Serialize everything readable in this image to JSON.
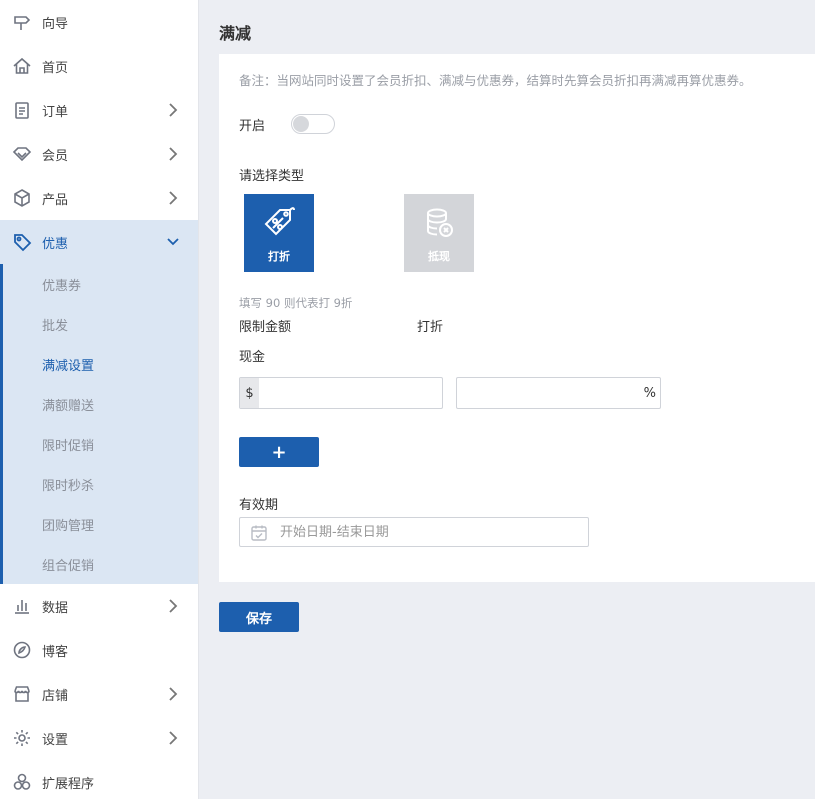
{
  "sidebar": {
    "items": [
      {
        "label": "向导",
        "icon": "signpost-icon",
        "has_chevron": false
      },
      {
        "label": "首页",
        "icon": "home-icon",
        "has_chevron": false
      },
      {
        "label": "订单",
        "icon": "clipboard-icon",
        "has_chevron": true
      },
      {
        "label": "会员",
        "icon": "diamond-icon",
        "has_chevron": true
      },
      {
        "label": "产品",
        "icon": "box-icon",
        "has_chevron": true
      },
      {
        "label": "优惠",
        "icon": "tag-icon",
        "has_chevron": true,
        "expanded": true,
        "active": true
      }
    ],
    "submenu": [
      {
        "label": "优惠券"
      },
      {
        "label": "批发"
      },
      {
        "label": "满减设置",
        "active": true
      },
      {
        "label": "满额赠送"
      },
      {
        "label": "限时促销"
      },
      {
        "label": "限时秒杀"
      },
      {
        "label": "团购管理"
      },
      {
        "label": "组合促销"
      }
    ],
    "items_after": [
      {
        "label": "数据",
        "icon": "bar-chart-icon",
        "has_chevron": true
      },
      {
        "label": "博客",
        "icon": "blog-icon",
        "has_chevron": false
      },
      {
        "label": "店铺",
        "icon": "store-icon",
        "has_chevron": true
      },
      {
        "label": "设置",
        "icon": "gear-icon",
        "has_chevron": true
      },
      {
        "label": "扩展程序",
        "icon": "extensions-icon",
        "has_chevron": false
      }
    ]
  },
  "page": {
    "title": "满减",
    "note": "备注：当网站同时设置了会员折扣、满减与优惠券，结算时先算会员折扣再满减再算优惠券。",
    "enable_label": "开启",
    "enable_on": false,
    "type_label": "请选择类型",
    "types": [
      {
        "label": "打折",
        "icon": "discount-tag-icon",
        "selected": true
      },
      {
        "label": "抵现",
        "icon": "coins-stack-icon",
        "selected": false
      }
    ],
    "hint": "填写 90 则代表打 9折",
    "col_amount": "限制金额",
    "col_discount": "打折",
    "cash_label": "现金",
    "amount_prefix": "$",
    "amount_value": "",
    "discount_suffix": "%",
    "discount_value": "",
    "add_button": "+",
    "validity_label": "有效期",
    "date_placeholder": "开始日期-结束日期",
    "save_button": "保存"
  },
  "colors": {
    "primary": "#1d5fae",
    "active_bg": "#dbe6f3",
    "page_bg": "#eceef3"
  }
}
